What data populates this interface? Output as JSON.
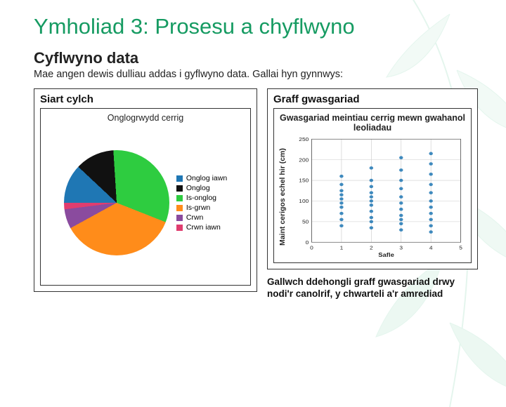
{
  "slide": {
    "title": "Ymholiad 3: Prosesu a chyflwyno",
    "section": "Cyflwyno data",
    "intro": "Mae angen dewis dulliau addas i gyflwyno data. Gallai hyn gynnwys:"
  },
  "left": {
    "label": "Siart cylch",
    "chart_title": "Onglogrwydd cerrig"
  },
  "right": {
    "label": "Graff gwasgariad",
    "chart_title": "Gwasgariad meintiau cerrig mewn gwahanol leoliadau",
    "ylabel": "Maint cerigos echel hir (cm)",
    "xlabel": "Safle",
    "caption": "Gallwch ddehongli graff gwasgariad drwy nodi'r canolrif, y chwarteli a'r amrediad"
  },
  "colors": {
    "accent": "#169b62",
    "pie": {
      "onglog_iawn": "#1f77b4",
      "onglog": "#111111",
      "is_onglog": "#2ecc40",
      "is_grwn": "#ff8c1a",
      "crwn": "#8a4b9e",
      "crwn_iawn": "#e03d6f"
    },
    "scatter_dot": "#1f77b4"
  },
  "chart_data": [
    {
      "type": "pie",
      "title": "Onglogrwydd cerrig",
      "series": [
        {
          "name": "Onglog iawn",
          "value": 12,
          "color": "#1f77b4"
        },
        {
          "name": "Onglog",
          "value": 12,
          "color": "#111111"
        },
        {
          "name": "Is-onglog",
          "value": 32,
          "color": "#2ecc40"
        },
        {
          "name": "Is-grwn",
          "value": 36,
          "color": "#ff8c1a"
        },
        {
          "name": "Crwn",
          "value": 6,
          "color": "#8a4b9e"
        },
        {
          "name": "Crwn iawn",
          "value": 2,
          "color": "#e03d6f"
        }
      ]
    },
    {
      "type": "scatter",
      "title": "Gwasgariad meintiau cerrig mewn gwahanol leoliadau",
      "xlabel": "Safle",
      "ylabel": "Maint cerigos echel hir (cm)",
      "xlim": [
        0,
        5
      ],
      "ylim": [
        0,
        250
      ],
      "xticks": [
        0,
        1,
        2,
        3,
        4,
        5
      ],
      "yticks": [
        0,
        50,
        100,
        150,
        200,
        250
      ],
      "series": [
        {
          "name": "meintiau",
          "points": [
            [
              1,
              40
            ],
            [
              1,
              55
            ],
            [
              1,
              70
            ],
            [
              1,
              85
            ],
            [
              1,
              95
            ],
            [
              1,
              105
            ],
            [
              1,
              115
            ],
            [
              1,
              125
            ],
            [
              1,
              140
            ],
            [
              1,
              160
            ],
            [
              2,
              35
            ],
            [
              2,
              50
            ],
            [
              2,
              60
            ],
            [
              2,
              75
            ],
            [
              2,
              90
            ],
            [
              2,
              100
            ],
            [
              2,
              110
            ],
            [
              2,
              120
            ],
            [
              2,
              135
            ],
            [
              2,
              150
            ],
            [
              2,
              180
            ],
            [
              3,
              30
            ],
            [
              3,
              45
            ],
            [
              3,
              55
            ],
            [
              3,
              65
            ],
            [
              3,
              80
            ],
            [
              3,
              95
            ],
            [
              3,
              110
            ],
            [
              3,
              130
            ],
            [
              3,
              150
            ],
            [
              3,
              175
            ],
            [
              3,
              205
            ],
            [
              4,
              25
            ],
            [
              4,
              40
            ],
            [
              4,
              55
            ],
            [
              4,
              70
            ],
            [
              4,
              85
            ],
            [
              4,
              100
            ],
            [
              4,
              120
            ],
            [
              4,
              140
            ],
            [
              4,
              165
            ],
            [
              4,
              190
            ],
            [
              4,
              215
            ]
          ]
        }
      ]
    }
  ]
}
